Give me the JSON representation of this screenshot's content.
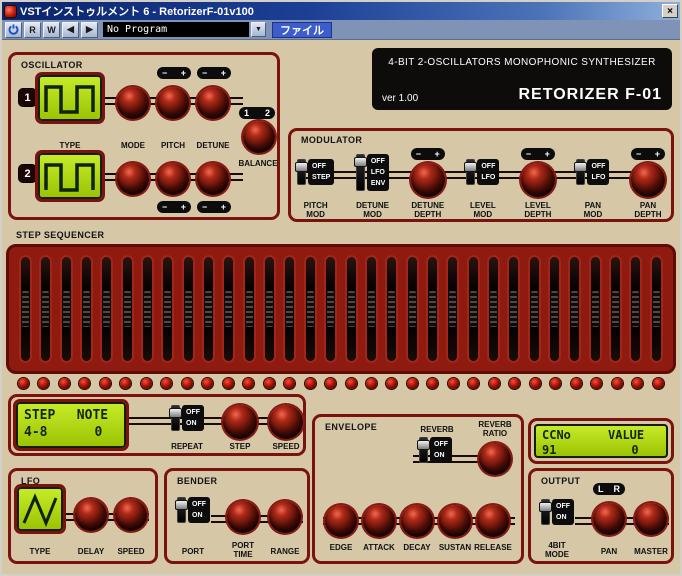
{
  "window": {
    "title": "VSTインストゥルメント 6 - RetorizerF-01v100",
    "close": "×"
  },
  "toolbar": {
    "read": "R",
    "write": "W",
    "prev": "◀",
    "next": "▶",
    "program": "No Program",
    "dropdown": "▼",
    "file": "ファイル"
  },
  "header": {
    "tagline": "4-BIT 2-OSCILLATORS MONOPHONIC SYNTHESIZER",
    "version": "ver 1.00",
    "model": "RETORIZER F-01"
  },
  "common": {
    "minus": "−",
    "plus": "+"
  },
  "oscillator": {
    "title": "OSCILLATOR",
    "osc1": "1",
    "osc2": "2",
    "bal_left": "1",
    "bal_right": "2",
    "type_label": "TYPE",
    "mode_label": "MODE",
    "pitch_label": "PITCH",
    "detune_label": "DETUNE",
    "balance_label": "BALANCE"
  },
  "modulator": {
    "title": "MODULATOR",
    "groups": [
      {
        "label1": "PITCH",
        "label2": "MOD",
        "options": [
          "OFF",
          "STEP"
        ],
        "value": "OFF"
      },
      {
        "label1": "DETUNE",
        "label2": "MOD",
        "options": [
          "OFF",
          "LFO",
          "ENV"
        ],
        "value": "OFF"
      },
      {
        "label1": "DETUNE",
        "label2": "DEPTH"
      },
      {
        "label1": "LEVEL",
        "label2": "MOD",
        "options": [
          "OFF",
          "LFO"
        ],
        "value": "OFF"
      },
      {
        "label1": "LEVEL",
        "label2": "DEPTH"
      },
      {
        "label1": "PAN",
        "label2": "MOD",
        "options": [
          "OFF",
          "LFO"
        ],
        "value": "OFF"
      },
      {
        "label1": "PAN",
        "label2": "DEPTH"
      }
    ]
  },
  "step_sequencer": {
    "title": "STEP SEQUENCER",
    "count": 32
  },
  "step_note": {
    "lcd": {
      "row1": [
        "STEP",
        "NOTE"
      ],
      "row2": [
        "4-8",
        "0"
      ]
    },
    "repeat_label": "REPEAT",
    "repeat_options": [
      "OFF",
      "ON"
    ],
    "repeat_value": "OFF",
    "step_label": "STEP",
    "speed_label": "SPEED"
  },
  "envelope": {
    "title": "ENVELOPE",
    "reverb_label": "REVERB",
    "reverb_options": [
      "OFF",
      "ON"
    ],
    "reverb_value": "OFF",
    "ratio_label1": "REVERB",
    "ratio_label2": "RATIO",
    "knob_labels": [
      "EDGE",
      "ATTACK",
      "DECAY",
      "SUSTAN",
      "RELEASE"
    ]
  },
  "cc_display": {
    "lcd": {
      "row1": [
        "CCNo",
        "VALUE"
      ],
      "row2": [
        "91",
        "0"
      ]
    }
  },
  "lfo": {
    "title": "LFO",
    "type_label": "TYPE",
    "delay_label": "DELAY",
    "speed_label": "SPEED"
  },
  "bender": {
    "title": "BENDER",
    "port_label": "PORT",
    "port_options": [
      "OFF",
      "ON"
    ],
    "port_value": "OFF",
    "porttime_label1": "PORT",
    "porttime_label2": "TIME",
    "range_label": "RANGE"
  },
  "output": {
    "title": "OUTPUT",
    "pan_left": "L",
    "pan_right": "R",
    "mode_label1": "4BIT",
    "mode_label2": "MODE",
    "mode_options": [
      "OFF",
      "ON"
    ],
    "mode_value": "OFF",
    "pan_label": "PAN",
    "master_label": "MASTER"
  }
}
